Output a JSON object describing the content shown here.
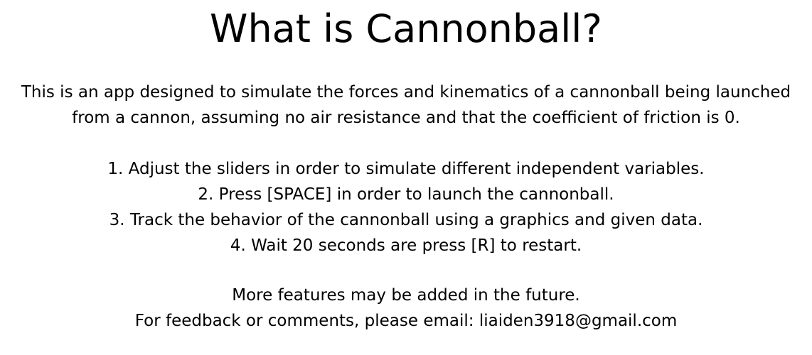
{
  "title": "What is Cannonball?",
  "intro": {
    "line1": "This is an app designed to simulate the forces and kinematics of a cannonball being launched",
    "line2": "from a cannon, assuming no air resistance and that the coefficient of friction is 0."
  },
  "steps": [
    "1. Adjust the sliders in order to simulate different independent variables.",
    "2. Press [SPACE] in order to launch the cannonball.",
    "3. Track the behavior of the cannonball using a graphics and given data.",
    "4. Wait 20 seconds are press [R] to restart."
  ],
  "footer": {
    "features": "More features may be added in the future.",
    "feedback": "For feedback or comments, please email: liaiden3918@gmail.com"
  }
}
